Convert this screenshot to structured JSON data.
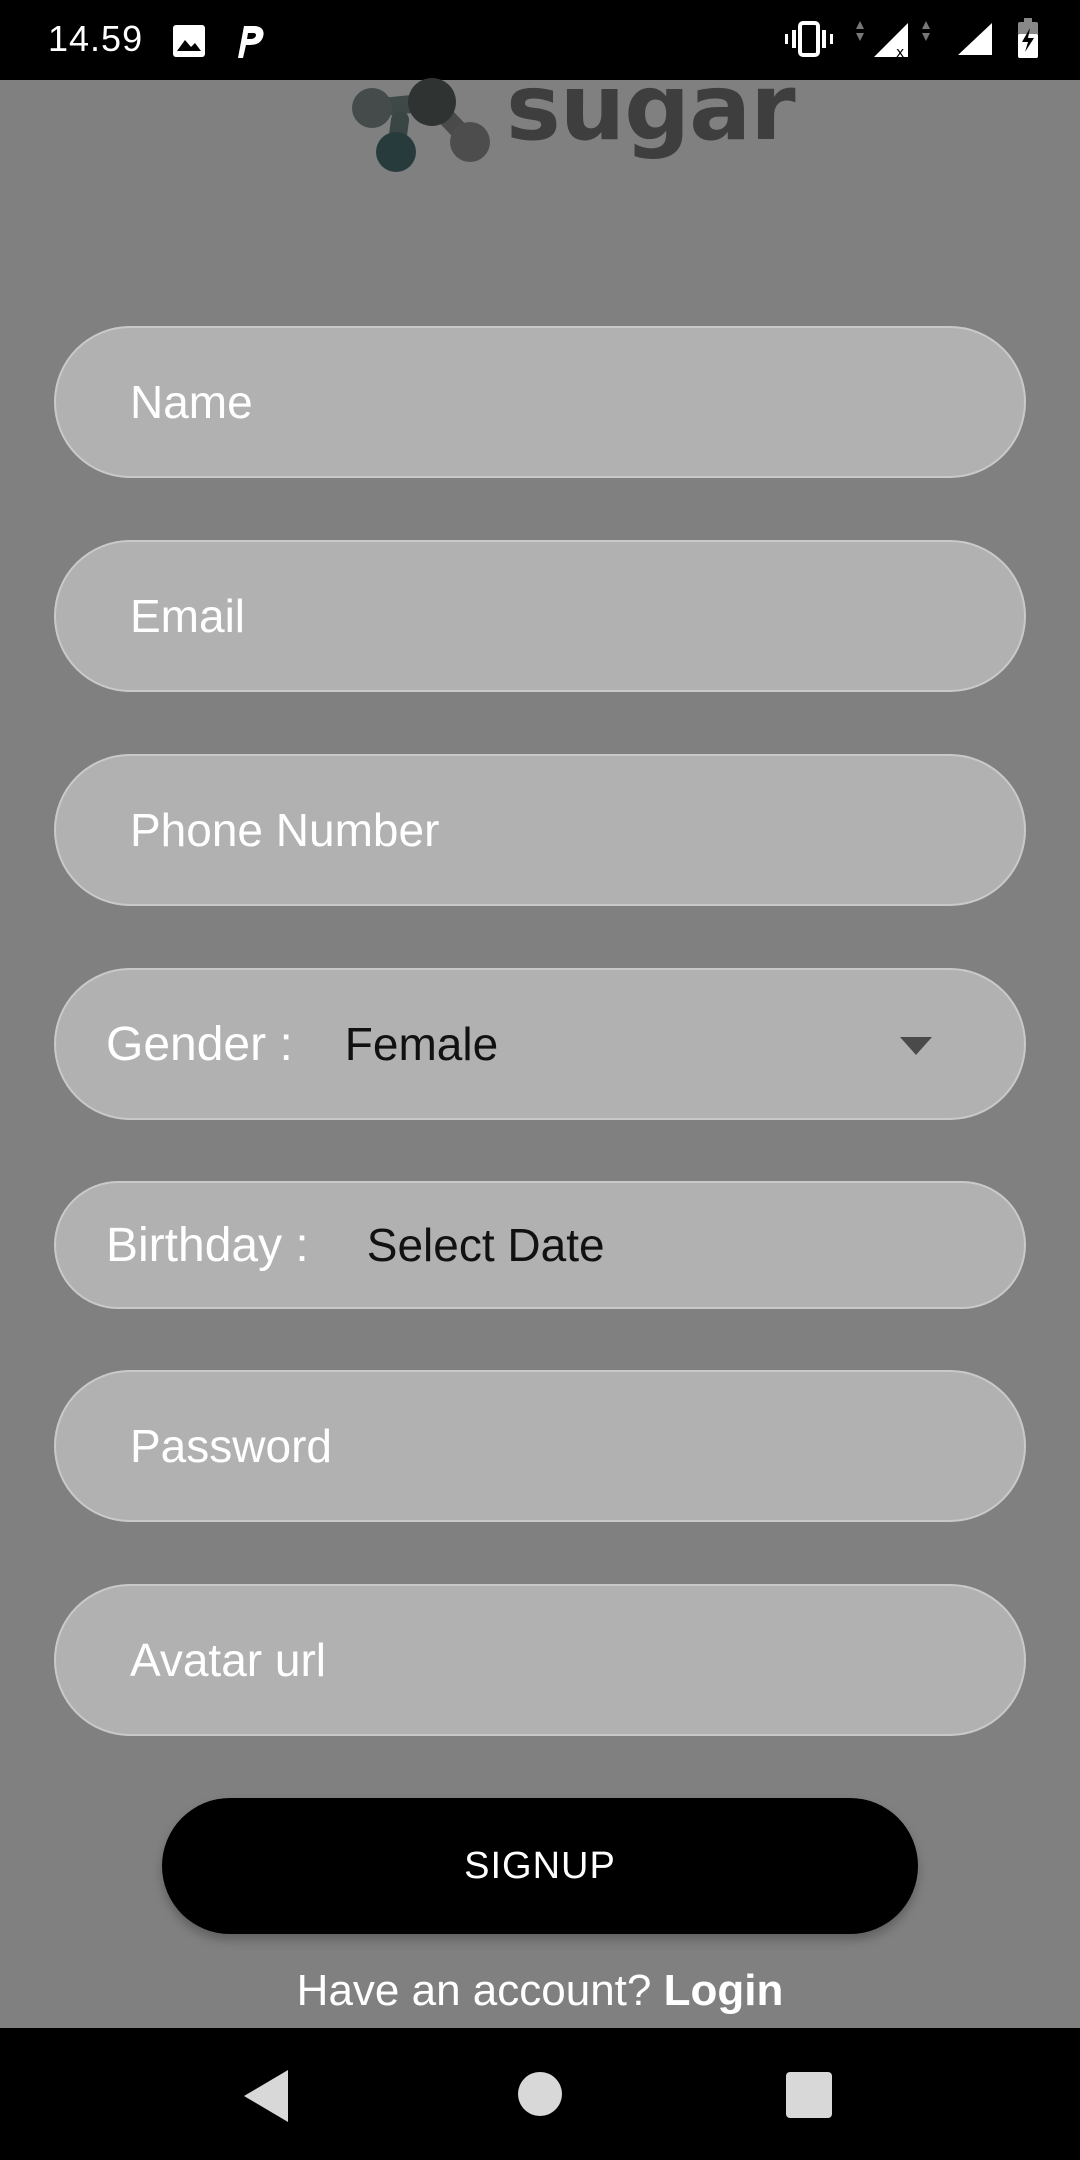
{
  "status_bar": {
    "time": "14.59",
    "left_icons": [
      "image-icon",
      "parking-icon"
    ],
    "right_icons": [
      "vibrate-icon",
      "signal-no-data-icon",
      "signal-icon",
      "battery-charging-icon"
    ]
  },
  "logo": {
    "text": "sugar",
    "icon": "molecule-logo-icon"
  },
  "form": {
    "name_placeholder": "Name",
    "email_placeholder": "Email",
    "phone_placeholder": "Phone Number",
    "gender_label": "Gender :",
    "gender_value": "Female",
    "birthday_label": "Birthday :",
    "birthday_value": "Select Date",
    "password_placeholder": "Password",
    "avatar_placeholder": "Avatar url"
  },
  "actions": {
    "signup_label": "SIGNUP",
    "have_account_text": "Have an account?",
    "login_label": "Login"
  },
  "nav_bar": {
    "icons": [
      "back-icon",
      "home-icon",
      "recents-icon"
    ]
  },
  "colors": {
    "overlay_bg": "#808080",
    "field_bg": "#b1b1b1",
    "button_bg": "#000000"
  }
}
